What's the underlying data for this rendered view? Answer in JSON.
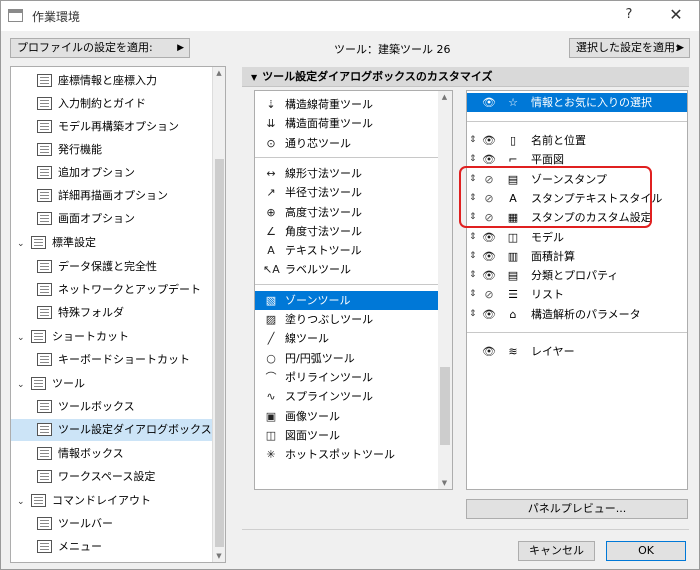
{
  "window": {
    "title": "作業環境",
    "help": "?",
    "close": "✕"
  },
  "header": {
    "profile_button": "プロファイルの設定を適用:",
    "tool_caption": "ツール：建築ツール 26",
    "apply_button": "選択した設定を適用:"
  },
  "left_tree": {
    "items": [
      {
        "label": "座標情報と座標入力",
        "icon": "xyz-icon",
        "glyph": "xyz"
      },
      {
        "label": "入力制約とガイド",
        "icon": "cursor-icon",
        "glyph": "↖"
      },
      {
        "label": "モデル再構築オプション",
        "icon": "bricks-icon",
        "glyph": "▦"
      },
      {
        "label": "発行機能",
        "icon": "publish-icon",
        "glyph": "▤"
      },
      {
        "label": "追加オプション",
        "icon": "sliders-icon",
        "glyph": "⫶"
      },
      {
        "label": "詳細再描画オプション",
        "icon": "redraw-icon",
        "glyph": "⌂"
      },
      {
        "label": "画面オプション",
        "icon": "monitor-icon",
        "glyph": "▭"
      },
      {
        "label": "標準設定",
        "icon": "folder-icon",
        "glyph": "▣",
        "expander": "⌄"
      },
      {
        "label": "データ保護と完全性",
        "icon": "shield-icon",
        "glyph": "◈"
      },
      {
        "label": "ネットワークとアップデート",
        "icon": "globe-icon",
        "glyph": "◍"
      },
      {
        "label": "特殊フォルダ",
        "icon": "special-folder-icon",
        "glyph": "▰"
      },
      {
        "label": "ショートカット",
        "icon": "shortcut-icon",
        "glyph": "▣",
        "expander": "⌄"
      },
      {
        "label": "キーボードショートカット",
        "icon": "arrow-box-icon",
        "glyph": "↗"
      },
      {
        "label": "ツール",
        "icon": "tools-icon",
        "glyph": "⌂",
        "expander": "⌄"
      },
      {
        "label": "ツールボックス",
        "icon": "toolbox-icon",
        "glyph": "▥"
      },
      {
        "label": "ツール設定ダイアログボックス",
        "icon": "tool-settings-icon",
        "glyph": "↗"
      },
      {
        "label": "情報ボックス",
        "icon": "info-box-icon",
        "glyph": "↗"
      },
      {
        "label": "ワークスペース設定",
        "icon": "workspace-icon",
        "glyph": "▭"
      },
      {
        "label": "コマンドレイアウト",
        "icon": "command-layout-icon",
        "glyph": "▣",
        "expander": "⌄"
      },
      {
        "label": "ツールバー",
        "icon": "toolbar-icon",
        "glyph": "▬"
      },
      {
        "label": "メニュー",
        "icon": "menu-icon",
        "glyph": "☰"
      }
    ],
    "selected_index": 15
  },
  "section": {
    "title": "ツール設定ダイアログボックスのカスタマイズ",
    "chevron": "▼"
  },
  "mid_list": {
    "groups": [
      [
        {
          "label": "構造線荷重ツール",
          "icon": "line-load-icon",
          "glyph": "⇣"
        },
        {
          "label": "構造面荷重ツール",
          "icon": "surface-load-icon",
          "glyph": "⇊"
        },
        {
          "label": "通り芯ツール",
          "icon": "grid-icon",
          "glyph": "⊙"
        }
      ],
      [
        {
          "label": "線形寸法ツール",
          "icon": "linear-dim-icon",
          "glyph": "↔"
        },
        {
          "label": "半径寸法ツール",
          "icon": "radial-dim-icon",
          "glyph": "↗"
        },
        {
          "label": "高度寸法ツール",
          "icon": "level-dim-icon",
          "glyph": "⊕"
        },
        {
          "label": "角度寸法ツール",
          "icon": "angle-dim-icon",
          "glyph": "∠"
        },
        {
          "label": "テキストツール",
          "icon": "text-icon",
          "glyph": "A"
        },
        {
          "label": "ラベルツール",
          "icon": "label-icon",
          "glyph": "↖A"
        }
      ],
      [
        {
          "label": "ゾーンツール",
          "icon": "zone-icon",
          "glyph": "▧"
        },
        {
          "label": "塗りつぶしツール",
          "icon": "fill-icon",
          "glyph": "▨"
        },
        {
          "label": "線ツール",
          "icon": "line-icon",
          "glyph": "╱"
        },
        {
          "label": "円/円弧ツール",
          "icon": "circle-icon",
          "glyph": "○"
        },
        {
          "label": "ポリラインツール",
          "icon": "polyline-icon",
          "glyph": "⌒"
        },
        {
          "label": "スプラインツール",
          "icon": "spline-icon",
          "glyph": "∿"
        },
        {
          "label": "画像ツール",
          "icon": "image-icon",
          "glyph": "▣"
        },
        {
          "label": "図面ツール",
          "icon": "drawing-icon",
          "glyph": "◫"
        },
        {
          "label": "ホットスポットツール",
          "icon": "hotspot-icon",
          "glyph": "✳"
        }
      ]
    ],
    "selected_label": "ゾーンツール"
  },
  "right_list": {
    "top": {
      "label": "情報とお気に入りの選択",
      "icon": "star-icon",
      "glyph": "☆",
      "eye": "👁"
    },
    "items": [
      {
        "label": "名前と位置",
        "icon": "tag-icon",
        "glyph": "▯",
        "visible": true
      },
      {
        "label": "平面図",
        "icon": "floorplan-icon",
        "glyph": "⌐",
        "visible": true
      },
      {
        "label": "ゾーンスタンプ",
        "icon": "stamp-icon",
        "glyph": "▤",
        "visible": false
      },
      {
        "label": "スタンプテキストスタイル",
        "icon": "stamp-text-icon",
        "glyph": "A",
        "visible": false
      },
      {
        "label": "スタンプのカスタム設定",
        "icon": "stamp-custom-icon",
        "glyph": "▦",
        "visible": false
      },
      {
        "label": "モデル",
        "icon": "model-icon",
        "glyph": "◫",
        "visible": true
      },
      {
        "label": "面積計算",
        "icon": "area-calc-icon",
        "glyph": "▥",
        "visible": true
      },
      {
        "label": "分類とプロパティ",
        "icon": "properties-icon",
        "glyph": "▤",
        "visible": true
      },
      {
        "label": "リスト",
        "icon": "list-icon",
        "glyph": "☰",
        "visible": false
      },
      {
        "label": "構造解析のパラメータ",
        "icon": "structural-icon",
        "glyph": "⌂",
        "visible": true
      }
    ],
    "bottom": {
      "label": "レイヤー",
      "icon": "layers-icon",
      "glyph": "≋",
      "eye": "👁"
    },
    "eye_on": "👁",
    "eye_off": "⊘",
    "drag": "⇕"
  },
  "buttons": {
    "preview": "パネルプレビュー...",
    "cancel": "キャンセル",
    "ok": "OK"
  },
  "colors": {
    "selection": "#0078d7",
    "tree_selection": "#cce4f7",
    "highlight_box": "#e02020"
  }
}
